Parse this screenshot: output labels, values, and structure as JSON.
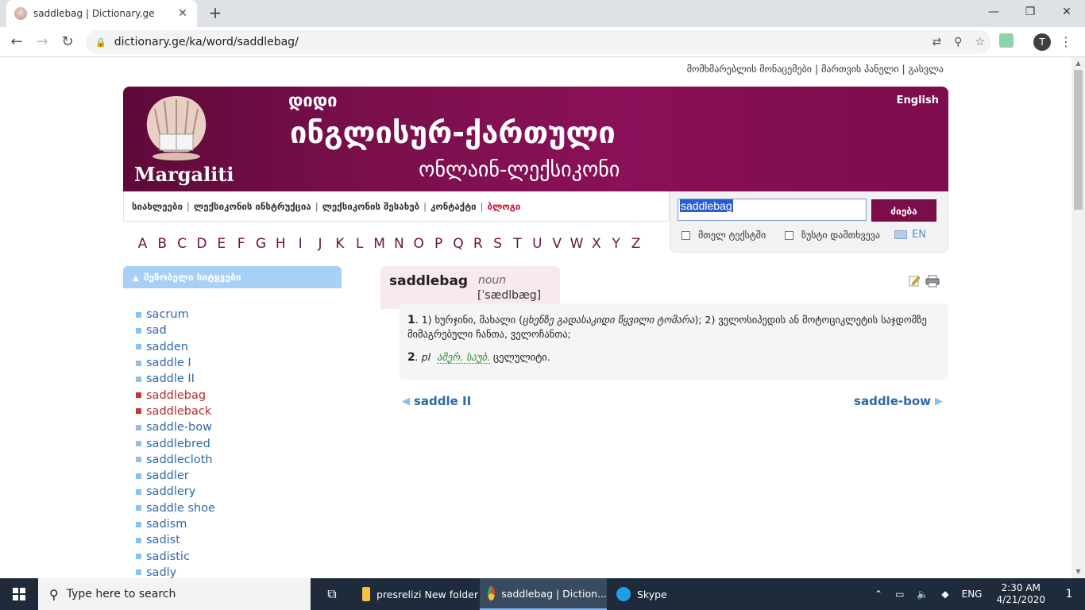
{
  "browser": {
    "tab_title": "saddlebag | Dictionary.ge",
    "tab_close": "✕",
    "new_tab": "+",
    "url": "dictionary.ge/ka/word/saddlebag/",
    "profile_initial": "T",
    "window_controls": {
      "minimize": "—",
      "maximize": "❐",
      "close": "✕"
    }
  },
  "site": {
    "user_links": [
      "მომხმარებლის მონაცემები",
      "მართვის პანელი",
      "გასვლა"
    ],
    "link_separator": "|",
    "banner": {
      "logo_name": "Margaliti",
      "line1": "დიდი",
      "line2": "ინგლისურ-ქართული",
      "line3": "ონლაინ-ლექსიკონი",
      "lang_switch": "English"
    },
    "nav": [
      "სიახლეები",
      "ლექსიკონის ინსტრუქცია",
      "ლექსიკონის შესახებ",
      "კონტაქტი",
      "ბლოგი"
    ],
    "search": {
      "query": "saddlebag",
      "button": "ძიება",
      "option_fulltext": "მთელ ტექსტში",
      "option_exact": "ზუსტი დამთხვევა",
      "lang": "EN"
    },
    "alphabet": [
      "A",
      "B",
      "C",
      "D",
      "E",
      "F",
      "G",
      "H",
      "I",
      "J",
      "K",
      "L",
      "M",
      "N",
      "O",
      "P",
      "Q",
      "R",
      "S",
      "T",
      "U",
      "V",
      "W",
      "X",
      "Y",
      "Z"
    ],
    "sidebar": {
      "title": "მეზობელი სიტყვები",
      "words": [
        "sacrum",
        "sad",
        "sadden",
        "saddle I",
        "saddle II",
        "saddlebag",
        "saddleback",
        "saddle-bow",
        "saddlebred",
        "saddlecloth",
        "saddler",
        "saddlery",
        "saddle shoe",
        "sadism",
        "sadist",
        "sadistic",
        "sadly"
      ],
      "active": [
        "saddlebag",
        "saddleback"
      ]
    },
    "entry": {
      "headword": "saddlebag",
      "pos": "noun",
      "pronunciation": "[ˈsædlbæg]",
      "def1_num": "1",
      "def1_a": ". 1) ხურჯინი, მახალი (",
      "def1_note": "ცხენზე გადასაკიდი წყვილი ტომარა",
      "def1_b": "); 2) ველოსიპედის ან მოტოციკლეტის საჯდომზე მიმაგრებული ჩანთა, ველოჩანთა;",
      "def2_num": "2",
      "def2_pl": ". pl",
      "def2_tag": "ამერ. საუბ.",
      "def2_text": "ცელულიტი."
    },
    "prev_word": "saddle II",
    "next_word": "saddle-bow"
  },
  "taskbar": {
    "search_placeholder": "Type here to search",
    "apps": [
      {
        "label": "presrelizi New folder",
        "color": "#f3c242"
      },
      {
        "label": "saddlebag | Diction...",
        "color": "#e34133"
      },
      {
        "label": "Skype",
        "color": "#1da1e6"
      }
    ],
    "lang": "ENG",
    "time": "2:30 AM",
    "date": "4/21/2020",
    "notification_count": "1"
  },
  "colors": {
    "banner": "#7a0f4c",
    "link": "#2f6aa6",
    "active_word": "#b52a2a",
    "sidebar_head": "#a8cff5"
  }
}
